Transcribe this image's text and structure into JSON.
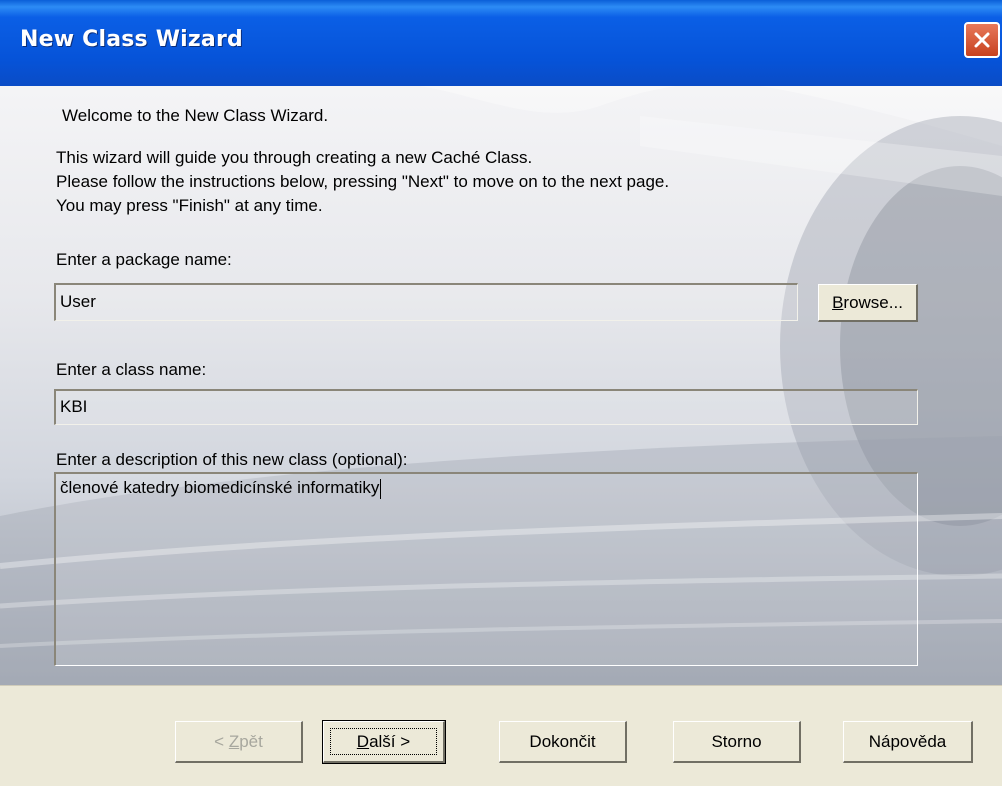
{
  "window": {
    "title": "New Class Wizard",
    "close_icon": "close-x-icon"
  },
  "intro": {
    "welcome": "Welcome to the New Class Wizard.",
    "line1": "This wizard will guide you through creating a new Caché Class.",
    "line2": "Please follow the instructions below, pressing \"Next\" to move on to the next page.",
    "line3": "You may press \"Finish\" at any time."
  },
  "package": {
    "label": "Enter a package name:",
    "value": "User",
    "browse_first": "B",
    "browse_rest": "rowse..."
  },
  "class": {
    "label": "Enter a class name:",
    "value": "KBI"
  },
  "description": {
    "label": "Enter a description of this new class (optional):",
    "value": "členové katedry biomedicínské informatiky"
  },
  "buttons": {
    "back_prefix": "< ",
    "back_mnemonic": "Z",
    "back_rest": "pět",
    "next_mnemonic": "D",
    "next_rest": "alší >",
    "finish": "Dokončit",
    "cancel": "Storno",
    "help": "Nápověda"
  },
  "colors": {
    "titlebar": "#0653D8",
    "face": "#ECE9D8",
    "close": "#C8421E"
  }
}
